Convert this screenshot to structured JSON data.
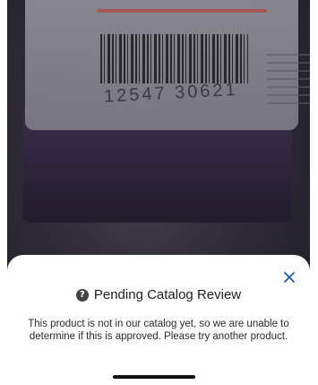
{
  "camera": {
    "barcode_digits": "12547 30621"
  },
  "modal": {
    "title": "Pending Catalog Review",
    "message": "This product is not in our catalog yet, so we are unable to determine if this is approved. Please try another product.",
    "close_icon": "close-icon",
    "help_icon": "question-circle-icon",
    "accent_color": "#1f5fa8"
  }
}
